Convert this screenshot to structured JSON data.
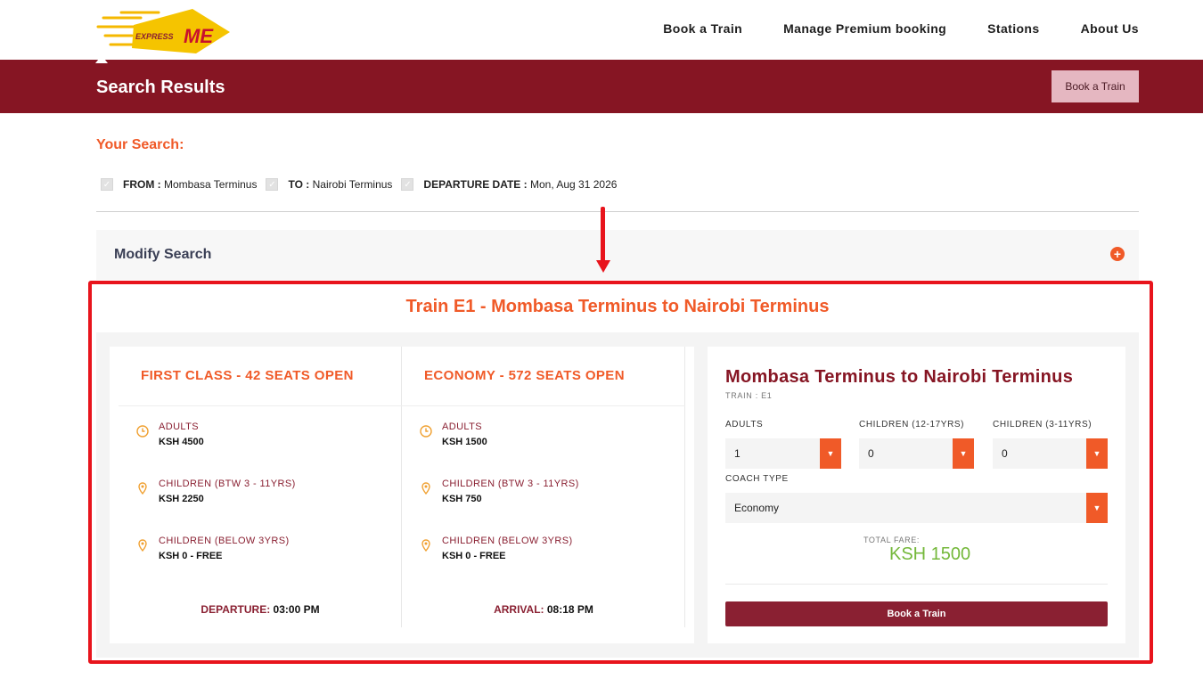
{
  "logo": {
    "prefix": "EXPRESS",
    "main": "ME"
  },
  "nav": {
    "items": [
      "Book a Train",
      "Manage Premium booking",
      "Stations",
      "About Us"
    ]
  },
  "banner": {
    "title": "Search Results",
    "button_label": "Book a Train"
  },
  "search": {
    "heading": "Your Search:",
    "from_label": "FROM :",
    "from_value": "Mombasa Terminus",
    "to_label": "TO :",
    "to_value": "Nairobi Terminus",
    "date_label": "DEPARTURE DATE :",
    "date_value": "Mon, Aug 31 2026"
  },
  "modify": {
    "label": "Modify Search"
  },
  "train": {
    "title": "Train E1 - Mombasa Terminus to Nairobi Terminus",
    "classes": [
      {
        "heading": "FIRST CLASS - 42 SEATS OPEN",
        "fares": [
          {
            "label": "ADULTS",
            "value": "KSH 4500"
          },
          {
            "label": "CHILDREN (BTW 3 - 11YRS)",
            "value": "KSH 2250"
          },
          {
            "label": "CHILDREN (BELOW 3YRS)",
            "value": "KSH 0 - FREE"
          }
        ],
        "time_label": "DEPARTURE:",
        "time_value": "03:00 PM"
      },
      {
        "heading": "ECONOMY - 572 SEATS OPEN",
        "fares": [
          {
            "label": "ADULTS",
            "value": "KSH 1500"
          },
          {
            "label": "CHILDREN (BTW 3 - 11YRS)",
            "value": "KSH 750"
          },
          {
            "label": "CHILDREN (BELOW 3YRS)",
            "value": "KSH 0 - FREE"
          }
        ],
        "time_label": "ARRIVAL:",
        "time_value": "08:18 PM"
      }
    ]
  },
  "booking": {
    "title": "Mombasa Terminus to Nairobi Terminus",
    "subtitle": "TRAIN : E1",
    "adults_label": "ADULTS",
    "adults_value": "1",
    "children_12_label": "CHILDREN (12-17YRS)",
    "children_12_value": "0",
    "children_3_label": "CHILDREN (3-11YRS)",
    "children_3_value": "0",
    "coach_label": "COACH TYPE",
    "coach_value": "Economy",
    "total_label": "TOTAL FARE:",
    "total_value": "KSH 1500",
    "button_label": "Book a Train"
  },
  "colors": {
    "brand": "#861523",
    "accent": "#f05a28",
    "highlight": "#e8141c",
    "fare_green": "#74b83a"
  },
  "icons": {
    "adults": "clock-icon",
    "children": "location-pin-icon",
    "modify": "plus-circle-icon",
    "dropdown": "caret-down-icon",
    "check": "checkbox-icon"
  }
}
